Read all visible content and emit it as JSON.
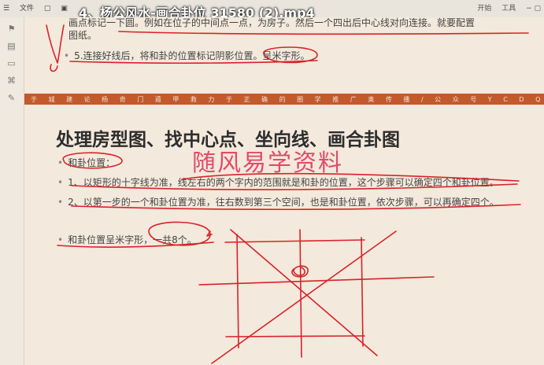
{
  "toolbar": {
    "file_menu": "文件",
    "right_item_1": "开始",
    "right_item_2": "工具",
    "title": "4、杨公风水-画合卦位 31580 (2).mp4"
  },
  "previous_page": {
    "line1": "画点标记一下圆。例如在位子的中间点一点，为房子。然后一个四出后中心线对向连接。就要配置",
    "line1b": "图纸。",
    "line2": "5.连接好线后，将和卦的位置标记阴影位置。呈米字形。"
  },
  "banner": "于 城 建 论 杨 奇 门 遁 甲 救 力 于 正 确 的 圈 学 推 广 奥 传 播 / 公 众 号 Y C D Q I M E N",
  "heading": "处理房型图、找中心点、坐向线、画合卦图",
  "watermark": "随风易学资料",
  "items": [
    "和卦位置：",
    "1、以矩形的十字线为准，线左右的两个字内的范围就是和卦的位置，这个步骤可以确定四个和卦位置。",
    "2、以第一步的一个和卦位置为准，往右数到第三个空间，也是和卦位置，依次步骤，可以再确定四个。",
    "和卦位置呈米字形，一共8个。"
  ],
  "bullet": "•",
  "colors": {
    "banner": "#c25a2c",
    "ink": "#d8232a",
    "watermark": "#e14b6a"
  }
}
